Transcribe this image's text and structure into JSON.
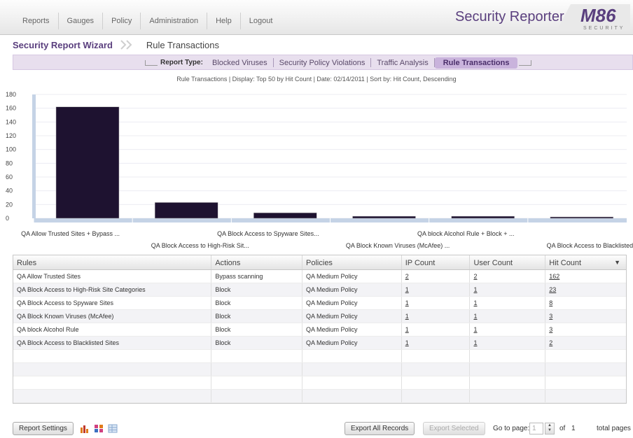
{
  "nav": {
    "items": [
      "Reports",
      "Gauges",
      "Policy",
      "Administration",
      "Help",
      "Logout"
    ],
    "app_title": "Security Reporter",
    "logo_text": "M86",
    "logo_sub": "SECURITY"
  },
  "wizard": {
    "title": "Security Report Wizard",
    "step": "Rule Transactions"
  },
  "report_type": {
    "label": "Report Type:",
    "items": [
      "Blocked Viruses",
      "Security Policy Violations",
      "Traffic Analysis",
      "Rule Transactions"
    ],
    "active_index": 3
  },
  "subtitle": "Rule Transactions  |  Display: Top 50 by Hit Count  |  Date: 02/14/2011  |  Sort by: Hit Count, Descending",
  "chart_data": {
    "type": "bar",
    "categories": [
      "QA Allow Trusted Sites + Bypass ...",
      "QA Block Access to High-Risk Sit...",
      "QA Block Access to Spyware Sites...",
      "QA Block Known Viruses (McAfee) ...",
      "QA block Alcohol Rule + Block + ...",
      "QA Block Access to Blacklisted S..."
    ],
    "values": [
      162,
      23,
      8,
      3,
      3,
      2
    ],
    "ylim": [
      0,
      180
    ],
    "yticks": [
      0,
      20,
      40,
      60,
      80,
      100,
      120,
      140,
      160,
      180
    ],
    "bar_color": "#1e1230",
    "grid": true
  },
  "table": {
    "headers": [
      "Rules",
      "Actions",
      "Policies",
      "IP Count",
      "User Count",
      "Hit Count"
    ],
    "rows": [
      [
        "QA Allow Trusted Sites",
        "Bypass scanning",
        "QA Medium Policy",
        "2",
        "2",
        "162"
      ],
      [
        "QA Block Access to High-Risk Site Categories",
        "Block",
        "QA Medium Policy",
        "1",
        "1",
        "23"
      ],
      [
        "QA Block Access to Spyware Sites",
        "Block",
        "QA Medium Policy",
        "1",
        "1",
        "8"
      ],
      [
        "QA Block Known Viruses (McAfee)",
        "Block",
        "QA Medium Policy",
        "1",
        "1",
        "3"
      ],
      [
        "QA block Alcohol Rule",
        "Block",
        "QA Medium Policy",
        "1",
        "1",
        "3"
      ],
      [
        "QA Block Access to Blacklisted Sites",
        "Block",
        "QA Medium Policy",
        "1",
        "1",
        "2"
      ]
    ]
  },
  "bottom": {
    "report_settings": "Report Settings",
    "export_all": "Export All Records",
    "export_selected": "Export Selected",
    "goto_label": "Go to page:",
    "page_value": "1",
    "of_label": "of",
    "total_pages": "1",
    "total_label": "total pages"
  }
}
